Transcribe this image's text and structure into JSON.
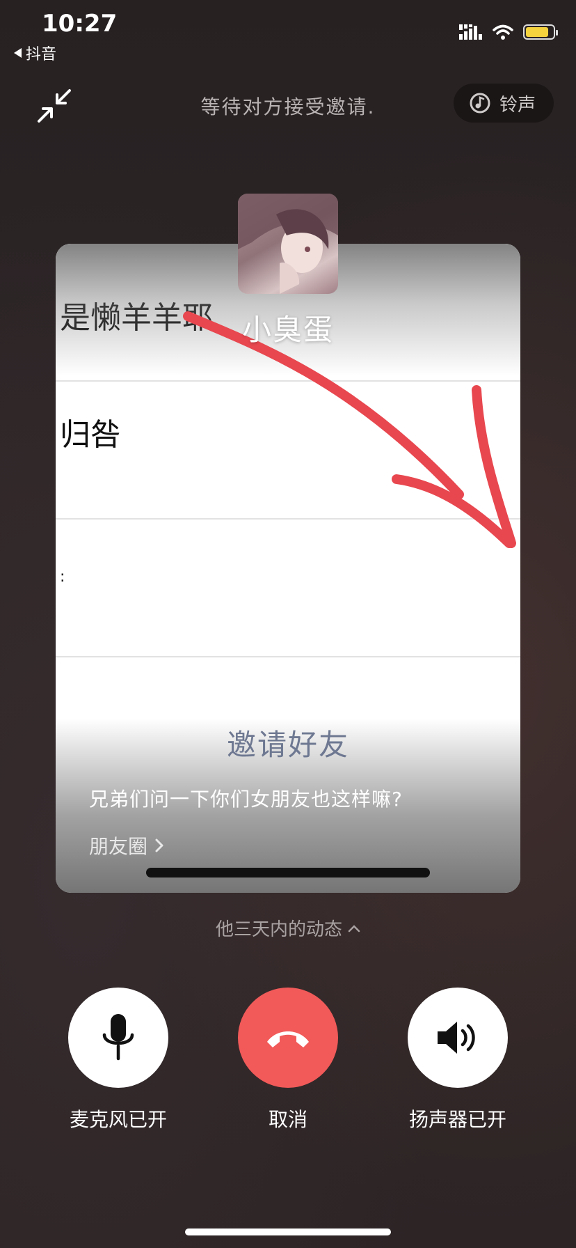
{
  "status_bar": {
    "time": "10:27",
    "back_app": "抖音",
    "battery_color": "#f5d33f"
  },
  "top_bar": {
    "waiting_text": "等待对方接受邀请.",
    "ringtone_label": "铃声"
  },
  "contact": {
    "name": "小臭蛋"
  },
  "card": {
    "rows": [
      {
        "text": "是懒羊羊耶"
      },
      {
        "text": "归咎"
      },
      {
        "text": ":"
      }
    ],
    "invite_title": "邀请好友",
    "moment_text": "兄弟们问一下你们女朋友也这样嘛?",
    "moment_link": "朋友圈"
  },
  "recent_moments_label": "他三天内的动态",
  "controls": {
    "mic": {
      "label": "麦克风已开",
      "icon": "microphone-icon"
    },
    "cancel": {
      "label": "取消",
      "icon": "hang-up-icon",
      "color": "#f15a59"
    },
    "speaker": {
      "label": "扬声器已开",
      "icon": "speaker-icon"
    }
  },
  "colors": {
    "background": "#2b2425",
    "cancel_red": "#f15a59",
    "annotation_arrow": "#e8474f"
  }
}
